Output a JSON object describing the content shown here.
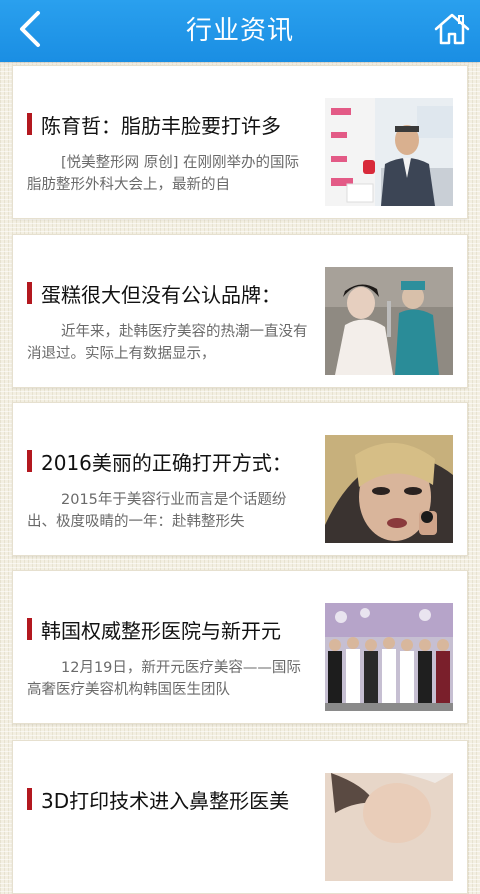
{
  "header": {
    "title": "行业资讯",
    "back_icon": "chevron-left-icon",
    "home_icon": "home-icon"
  },
  "articles": [
    {
      "title": "陈育哲：脂肪丰脸要打许多",
      "summary": "[悦美整形网 原创] 在刚刚举办的国际脂肪整形外科大会上，最新的自",
      "thumb": "interview-photo"
    },
    {
      "title": "蛋糕很大但没有公认品牌：",
      "summary": "近年来，赴韩医疗美容的热潮一直没有消退过。实际上有数据显示，",
      "thumb": "salon-photo"
    },
    {
      "title": "2016美丽的正确打开方式：",
      "summary": "2015年于美容行业而言是个话题纷出、极度吸睛的一年：赴韩整形失",
      "thumb": "beauty-portrait-photo"
    },
    {
      "title": "韩国权威整形医院与新开元",
      "summary": "12月19日，新开元医疗美容——国际高奢医疗美容机构韩国医生团队",
      "thumb": "group-photo"
    },
    {
      "title": "3D打印技术进入鼻整形医美",
      "summary": "",
      "thumb": "face-closeup-photo"
    }
  ],
  "colors": {
    "header": "#1a8ee3",
    "title_bar": "#b3181f",
    "background": "#f3efe2"
  }
}
